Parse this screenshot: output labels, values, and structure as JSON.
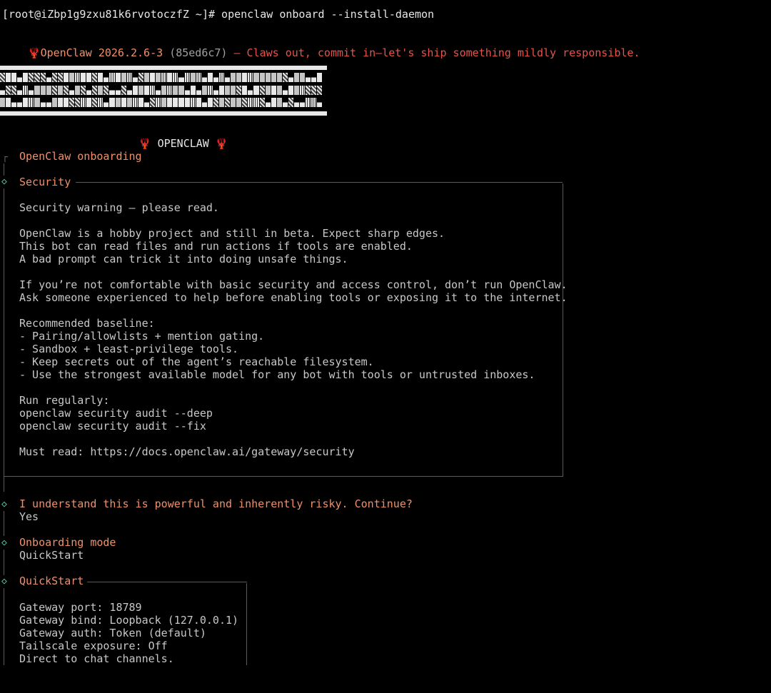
{
  "prompt": "[root@iZbp1g9zxu81k6rvotoczfZ ~]# openclaw onboard --install-daemon",
  "version": {
    "icon": "lobster-icon",
    "name_version": "OpenClaw 2026.2.6-3",
    "hash": "(85ed6c7)",
    "tagline": "– Claws out, commit in—let's ship something mildly responsible."
  },
  "banner_title": "OPENCLAW",
  "onboarding_title": "OpenClaw onboarding",
  "security": {
    "title": "Security",
    "warning": "Security warning — please read.",
    "para1": [
      "OpenClaw is a hobby project and still in beta. Expect sharp edges.",
      "This bot can read files and run actions if tools are enabled.",
      "A bad prompt can trick it into doing unsafe things."
    ],
    "para2": [
      "If you’re not comfortable with basic security and access control, don’t run OpenClaw.",
      "Ask someone experienced to help before enabling tools or exposing it to the internet."
    ],
    "baseline_title": "Recommended baseline:",
    "baseline": [
      "- Pairing/allowlists + mention gating.",
      "- Sandbox + least-privilege tools.",
      "- Keep secrets out of the agent’s reachable filesystem.",
      "- Use the strongest available model for any bot with tools or untrusted inboxes."
    ],
    "run_title": "Run regularly:",
    "commands": [
      "openclaw security audit --deep",
      "openclaw security audit --fix"
    ],
    "must_read": "Must read: https://docs.openclaw.ai/gateway/security"
  },
  "confirm": {
    "question": "I understand this is powerful and inherently risky. Continue?",
    "answer": "Yes"
  },
  "mode": {
    "title": "Onboarding mode",
    "value": "QuickStart"
  },
  "quickstart": {
    "title": "QuickStart",
    "lines": [
      "Gateway port: 18789",
      "Gateway bind: Loopback (127.0.0.1)",
      "Gateway auth: Token (default)",
      "Tailscale exposure: Off",
      "Direct to chat channels."
    ]
  },
  "colors": {
    "accent": "#f0906a",
    "diamond": "#5fcfae",
    "text": "#c8c8c8",
    "background": "#000000"
  }
}
